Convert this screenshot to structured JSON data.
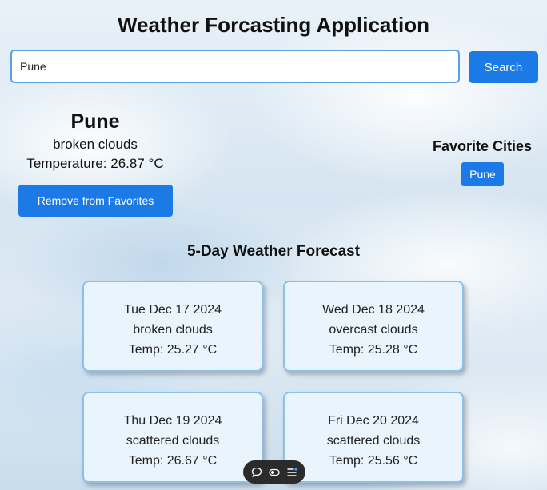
{
  "app": {
    "title": "Weather Forcasting Application"
  },
  "search": {
    "value": "Pune",
    "button_label": "Search"
  },
  "current": {
    "city": "Pune",
    "description": "broken clouds",
    "temperature": "Temperature: 26.87 °C",
    "favorite_button_label": "Remove from Favorites"
  },
  "favorites": {
    "heading": "Favorite Cities",
    "cities": [
      "Pune"
    ]
  },
  "forecast": {
    "heading": "5-Day Weather Forecast",
    "days": [
      {
        "date": "Tue Dec 17 2024",
        "description": "broken clouds",
        "temp": "Temp: 25.27 °C"
      },
      {
        "date": "Wed Dec 18 2024",
        "description": "overcast clouds",
        "temp": "Temp: 25.28 °C"
      },
      {
        "date": "Thu Dec 19 2024",
        "description": "scattered clouds",
        "temp": "Temp: 26.67 °C"
      },
      {
        "date": "Fri Dec 20 2024",
        "description": "scattered clouds",
        "temp": "Temp: 25.56 °C"
      }
    ]
  },
  "toolbar": {
    "icons": [
      "chat-icon",
      "toggle-icon",
      "menu-icon"
    ]
  },
  "colors": {
    "accent": "#1b7ae6",
    "card_bg": "#eaf4fd",
    "card_border": "#8cc0ea"
  }
}
